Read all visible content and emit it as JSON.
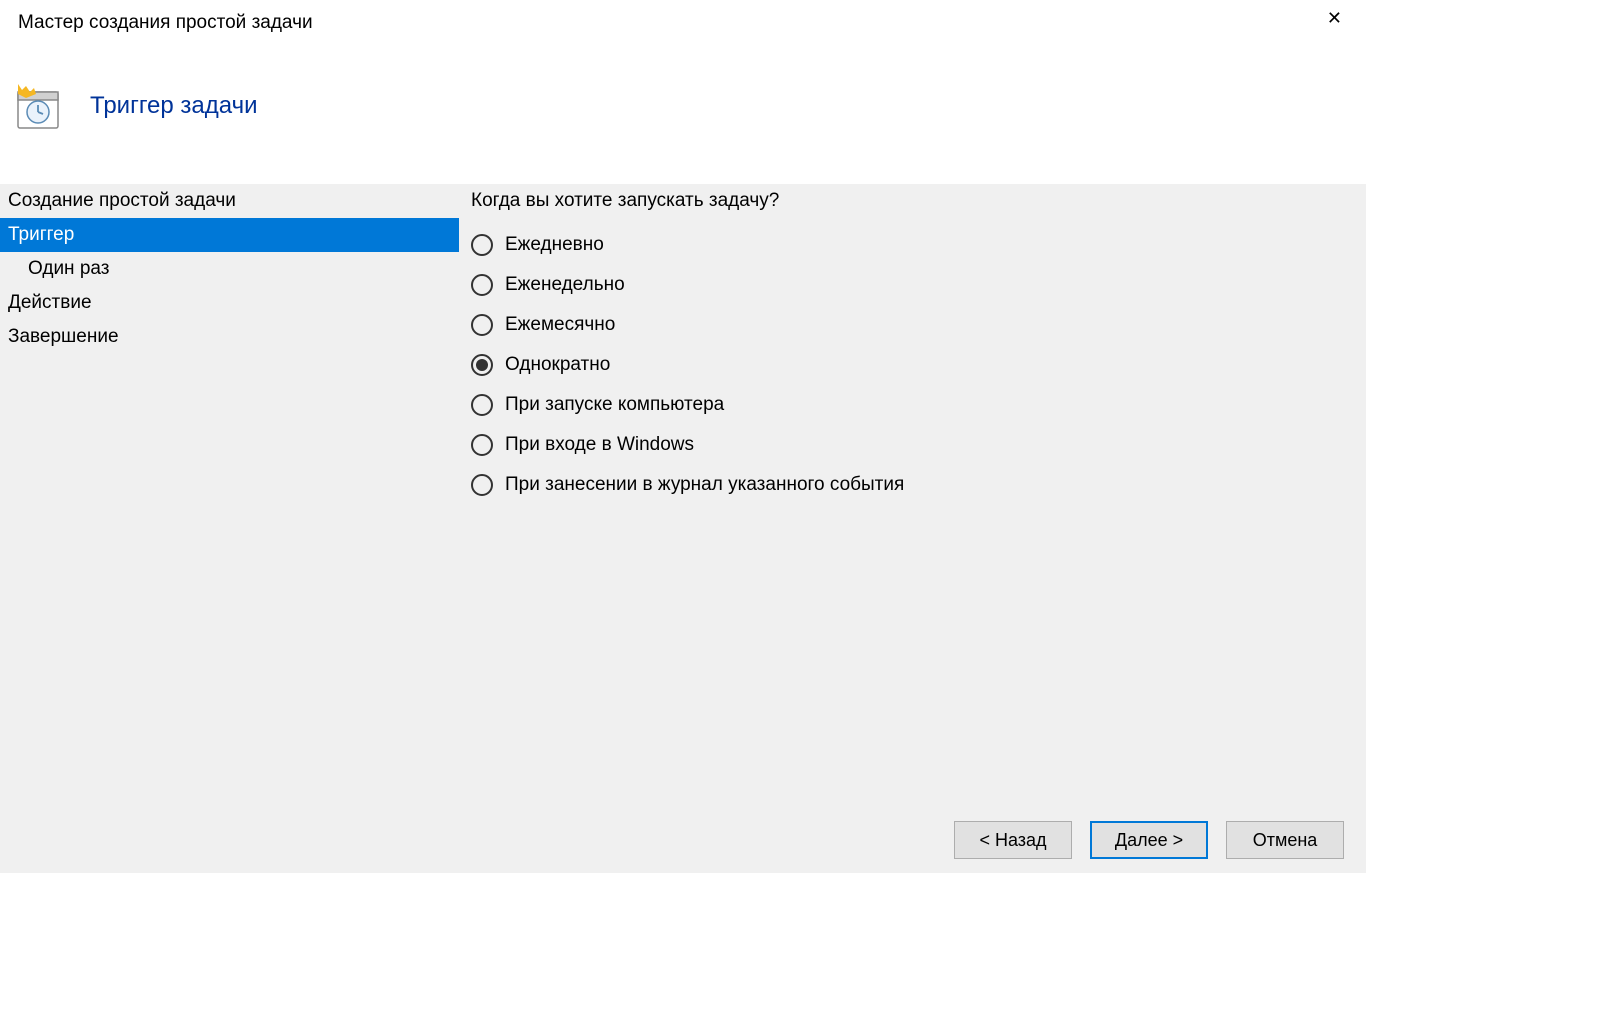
{
  "window": {
    "title": "Мастер создания простой задачи"
  },
  "header": {
    "title": "Триггер задачи"
  },
  "sidebar": {
    "items": [
      {
        "label": "Создание простой задачи",
        "selected": false,
        "indent": false
      },
      {
        "label": "Триггер",
        "selected": true,
        "indent": false
      },
      {
        "label": "Один раз",
        "selected": false,
        "indent": true
      },
      {
        "label": "Действие",
        "selected": false,
        "indent": false
      },
      {
        "label": "Завершение",
        "selected": false,
        "indent": false
      }
    ]
  },
  "main": {
    "question": "Когда вы хотите запускать задачу?",
    "options": [
      {
        "label": "Ежедневно",
        "checked": false
      },
      {
        "label": "Еженедельно",
        "checked": false
      },
      {
        "label": "Ежемесячно",
        "checked": false
      },
      {
        "label": "Однократно",
        "checked": true
      },
      {
        "label": "При запуске компьютера",
        "checked": false
      },
      {
        "label": "При входе в Windows",
        "checked": false
      },
      {
        "label": "При занесении в журнал указанного события",
        "checked": false
      }
    ]
  },
  "footer": {
    "back": "< Назад",
    "next": "Далее >",
    "cancel": "Отмена"
  }
}
